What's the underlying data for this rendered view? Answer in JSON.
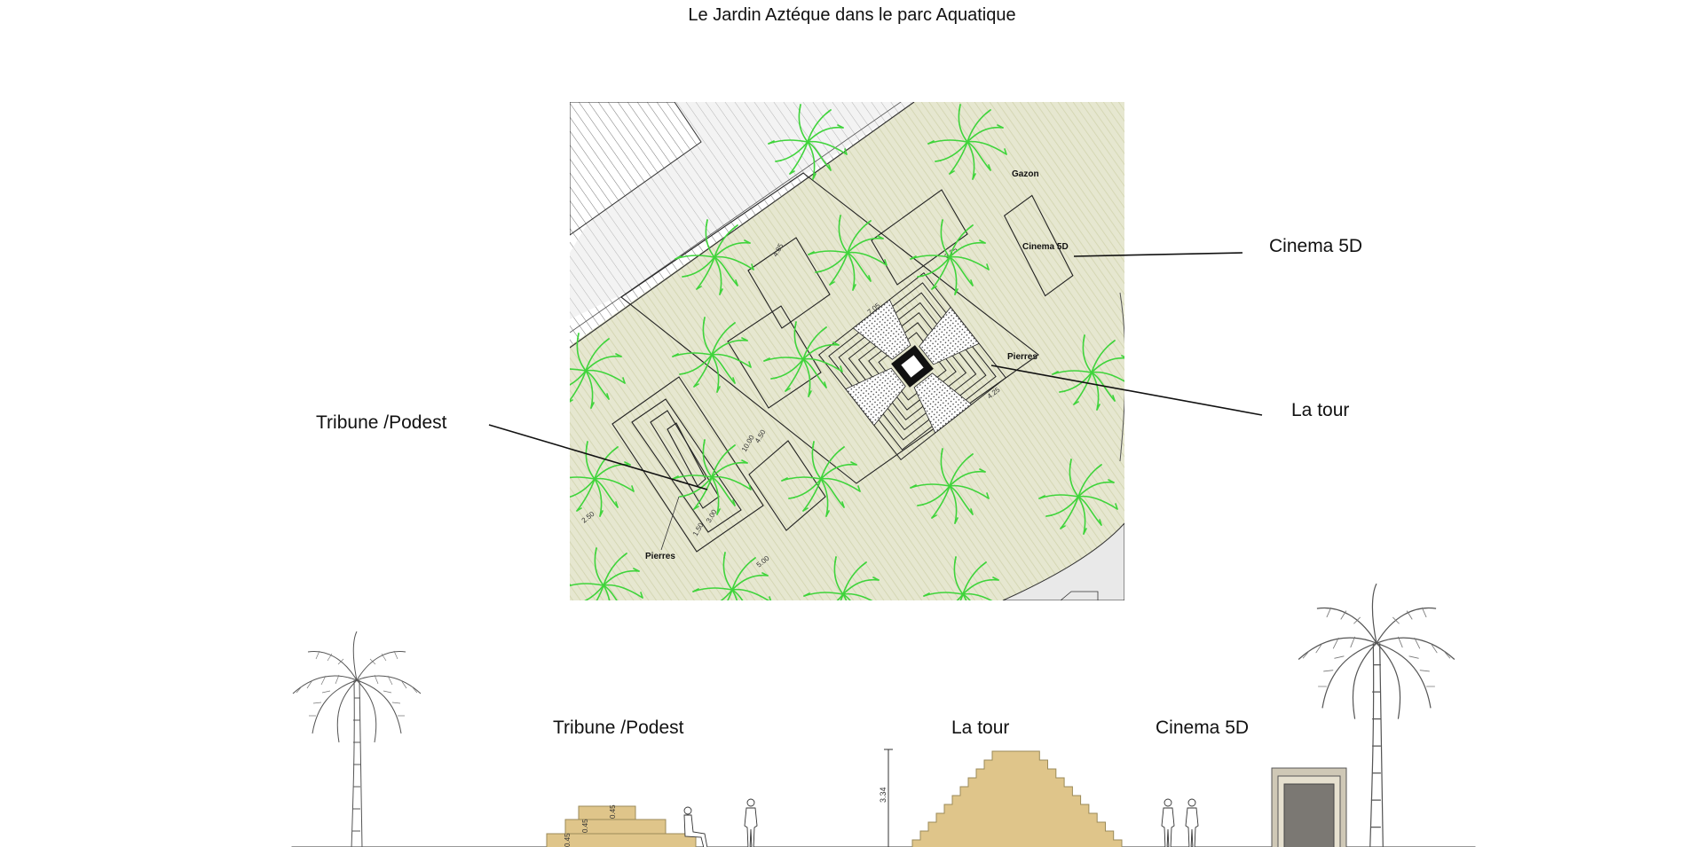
{
  "title": "Le Jardin Aztéque dans le parc Aquatique",
  "plan": {
    "callouts": {
      "cinema": "Cinema 5D",
      "tower": "La tour",
      "tribune": "Tribune /Podest"
    },
    "inner_labels": {
      "gazon": "Gazon",
      "cinema": "Cinema 5D",
      "pierres_right": "Pierres",
      "pierres_left": "Pierres"
    },
    "dimensions": {
      "d1": "4.85",
      "d2": "7.05",
      "d3": "3.25",
      "d4": "10.00",
      "d5": "4.50",
      "d6": "1.50",
      "d7": "3.00",
      "d8": "5.00",
      "d9": "2.50",
      "d10": "4.25"
    },
    "colors": {
      "lawn": "#e6e7d0",
      "palm": "#3fd43b",
      "line": "#222222"
    }
  },
  "elevation": {
    "labels": {
      "tribune": "Tribune /Podest",
      "tower": "La tour",
      "cinema": "Cinema 5D"
    },
    "height_mark": "3.34",
    "step_marks": {
      "s1": "0.45",
      "s2": "0.45",
      "s3": "0.45"
    },
    "colors": {
      "sand": "#dfc58a",
      "building": "#7b7873",
      "frame": "#cfc8b6"
    }
  }
}
